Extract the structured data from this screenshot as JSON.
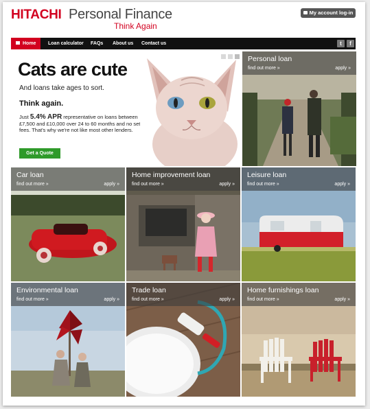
{
  "header": {
    "brand": "HITACHI",
    "product": "Personal Finance",
    "tagline": "Think Again",
    "account_button": "My account log-in"
  },
  "nav": {
    "items": [
      {
        "label": "Home",
        "active": true
      },
      {
        "label": "Loan calculator"
      },
      {
        "label": "FAQs"
      },
      {
        "label": "About us"
      },
      {
        "label": "Contact us"
      }
    ],
    "social": [
      "twitter-icon",
      "facebook-icon"
    ]
  },
  "hero": {
    "title": "Cats are cute",
    "subtitle": "And loans take ages to sort.",
    "think": "Think again.",
    "body_prefix": "Just",
    "apr": "5.4% APR",
    "body_suffix": "representative on loans between £7,500 and £10,000 over 24 to 60 months and no set-up fees. That's why we're not like most other lenders.",
    "cta": "Get a Quote"
  },
  "tiles": [
    {
      "title": "Personal loan",
      "more": "find out more »",
      "apply": "apply »"
    },
    {
      "title": "Car loan",
      "more": "find out more »",
      "apply": "apply »"
    },
    {
      "title": "Home improvement loan",
      "more": "find out more »",
      "apply": "apply »"
    },
    {
      "title": "Leisure loan",
      "more": "find out more »",
      "apply": "apply »"
    },
    {
      "title": "Environmental loan",
      "more": "find out more »",
      "apply": "apply »"
    },
    {
      "title": "Trade loan",
      "more": "find out more »",
      "apply": "apply »"
    },
    {
      "title": "Home furnishings loan",
      "more": "find out more »",
      "apply": "apply »"
    }
  ],
  "colors": {
    "brand_red": "#d2001f",
    "nav_bg": "#111111",
    "cta_green": "#2f9a2a"
  }
}
